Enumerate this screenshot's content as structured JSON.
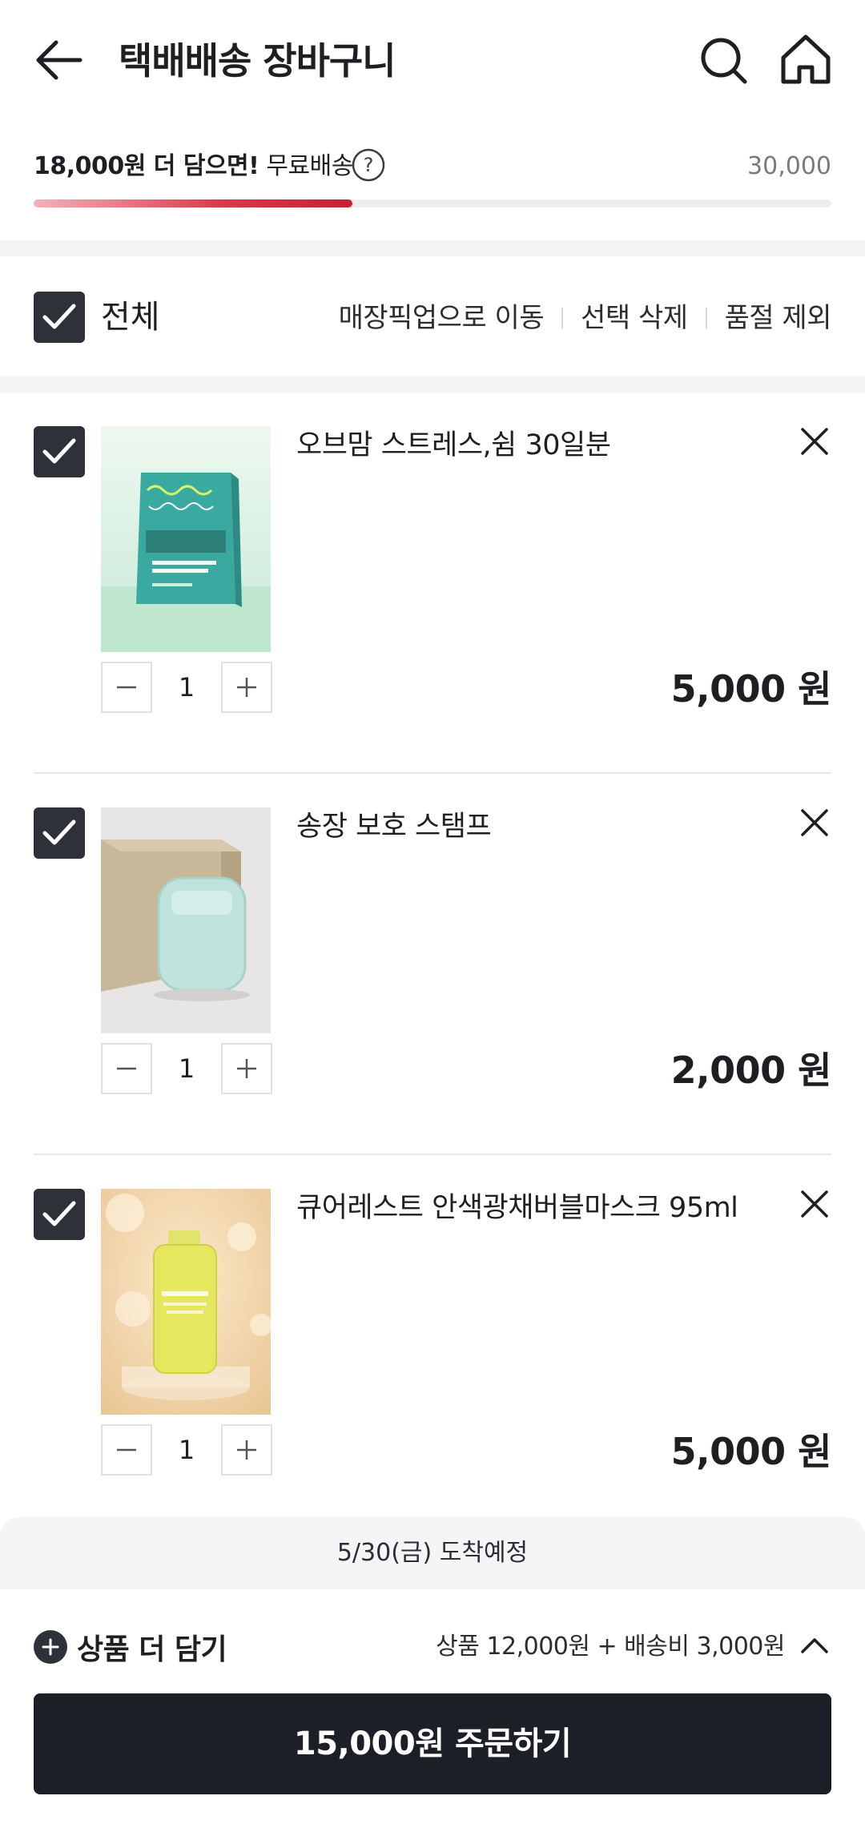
{
  "header": {
    "title": "택배배송 장바구니",
    "icons": [
      "back-arrow-icon",
      "search-icon",
      "home-icon"
    ]
  },
  "shipping": {
    "remaining_text": "18,000원 더 담으면!",
    "free_label": "무료배송",
    "target": "30,000",
    "progress_fraction": 0.4
  },
  "select_bar": {
    "select_all_label": "전체",
    "actions": [
      "매장픽업으로 이동",
      "선택 삭제",
      "품절 제외"
    ]
  },
  "items": [
    {
      "name": "오브맘 스트레스,쉼 30일분",
      "quantity": "1",
      "price": "5,000 원",
      "checked": true
    },
    {
      "name": "송장 보호 스탬프",
      "quantity": "1",
      "price": "2,000 원",
      "checked": true
    },
    {
      "name": "큐어레스트 안색광채버블마스크 95ml",
      "quantity": "1",
      "price": "5,000 원",
      "checked": true
    }
  ],
  "arrival": "5/30(금) 도착예정",
  "bottom": {
    "add_more_label": "상품 더 담기",
    "summary": "상품 12,000원 + 배송비 3,000원",
    "order_button": "15,000원 주문하기"
  },
  "colors": {
    "primary_dark": "#1c1f26",
    "progress_red": "#d63a48",
    "divider": "#f4f5f7"
  }
}
